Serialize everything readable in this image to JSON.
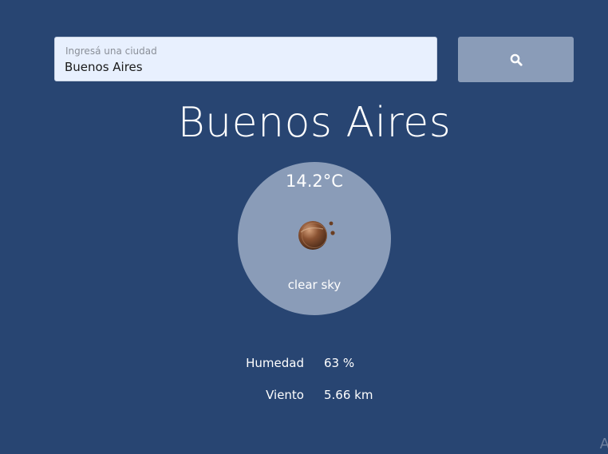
{
  "search": {
    "label": "Ingresá una ciudad",
    "value": "Buenos Aires",
    "button_icon": "search-icon"
  },
  "city": {
    "name": "Buenos Aires"
  },
  "weather": {
    "temperature": "14.2°C",
    "description": "clear sky",
    "icon": "moon-icon"
  },
  "details": [
    {
      "label": "Humedad",
      "value": "63 %"
    },
    {
      "label": "Viento",
      "value": "5.66 km"
    }
  ],
  "colors": {
    "background": "#284572",
    "accent": "#8a9cb8",
    "input_background": "#e8f0fe"
  }
}
